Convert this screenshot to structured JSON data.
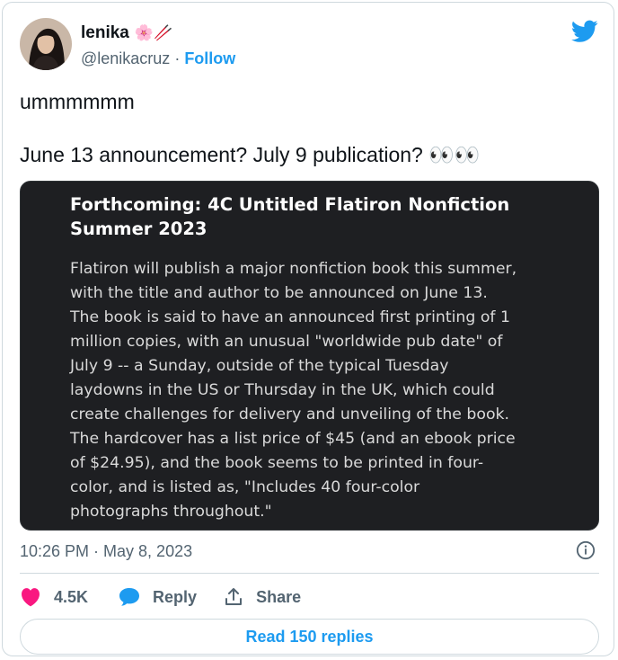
{
  "author": {
    "display_name": "lenika",
    "name_emojis": "🌸🥢",
    "handle": "@lenikacruz",
    "separator": " · ",
    "follow_label": "Follow"
  },
  "tweet": {
    "line1": "ummmmmm",
    "line2": "June 13 announcement? July 9 publication? 👀👀"
  },
  "media": {
    "title_line1": "Forthcoming: 4C Untitled Flatiron Nonfiction",
    "title_line2": "Summer 2023",
    "body_lines": [
      "Flatiron will publish a major nonfiction book this summer,",
      "with the title and author to be announced on June 13.",
      "The book is said to have an announced first printing of 1",
      "million copies, with an unusual \"worldwide pub date\" of",
      "July 9 -- a Sunday, outside of the typical Tuesday",
      "laydowns in the US or Thursday in the UK, which could",
      "create challenges for delivery and unveiling of the book.",
      "The hardcover has a list price of $45 (and an ebook price",
      "of $24.95), and the book seems to be printed in four-",
      "color, and is listed as, \"Includes 40 four-color",
      "photographs throughout.\""
    ]
  },
  "meta": {
    "timestamp": "10:26 PM · May 8, 2023"
  },
  "actions": {
    "likes": "4.5K",
    "reply_label": "Reply",
    "share_label": "Share"
  },
  "footer": {
    "read_replies_label": "Read 150 replies"
  },
  "colors": {
    "accent": "#1d9bf0",
    "heart": "#f91880",
    "muted": "#536471",
    "media_bg": "#1e1f22"
  }
}
